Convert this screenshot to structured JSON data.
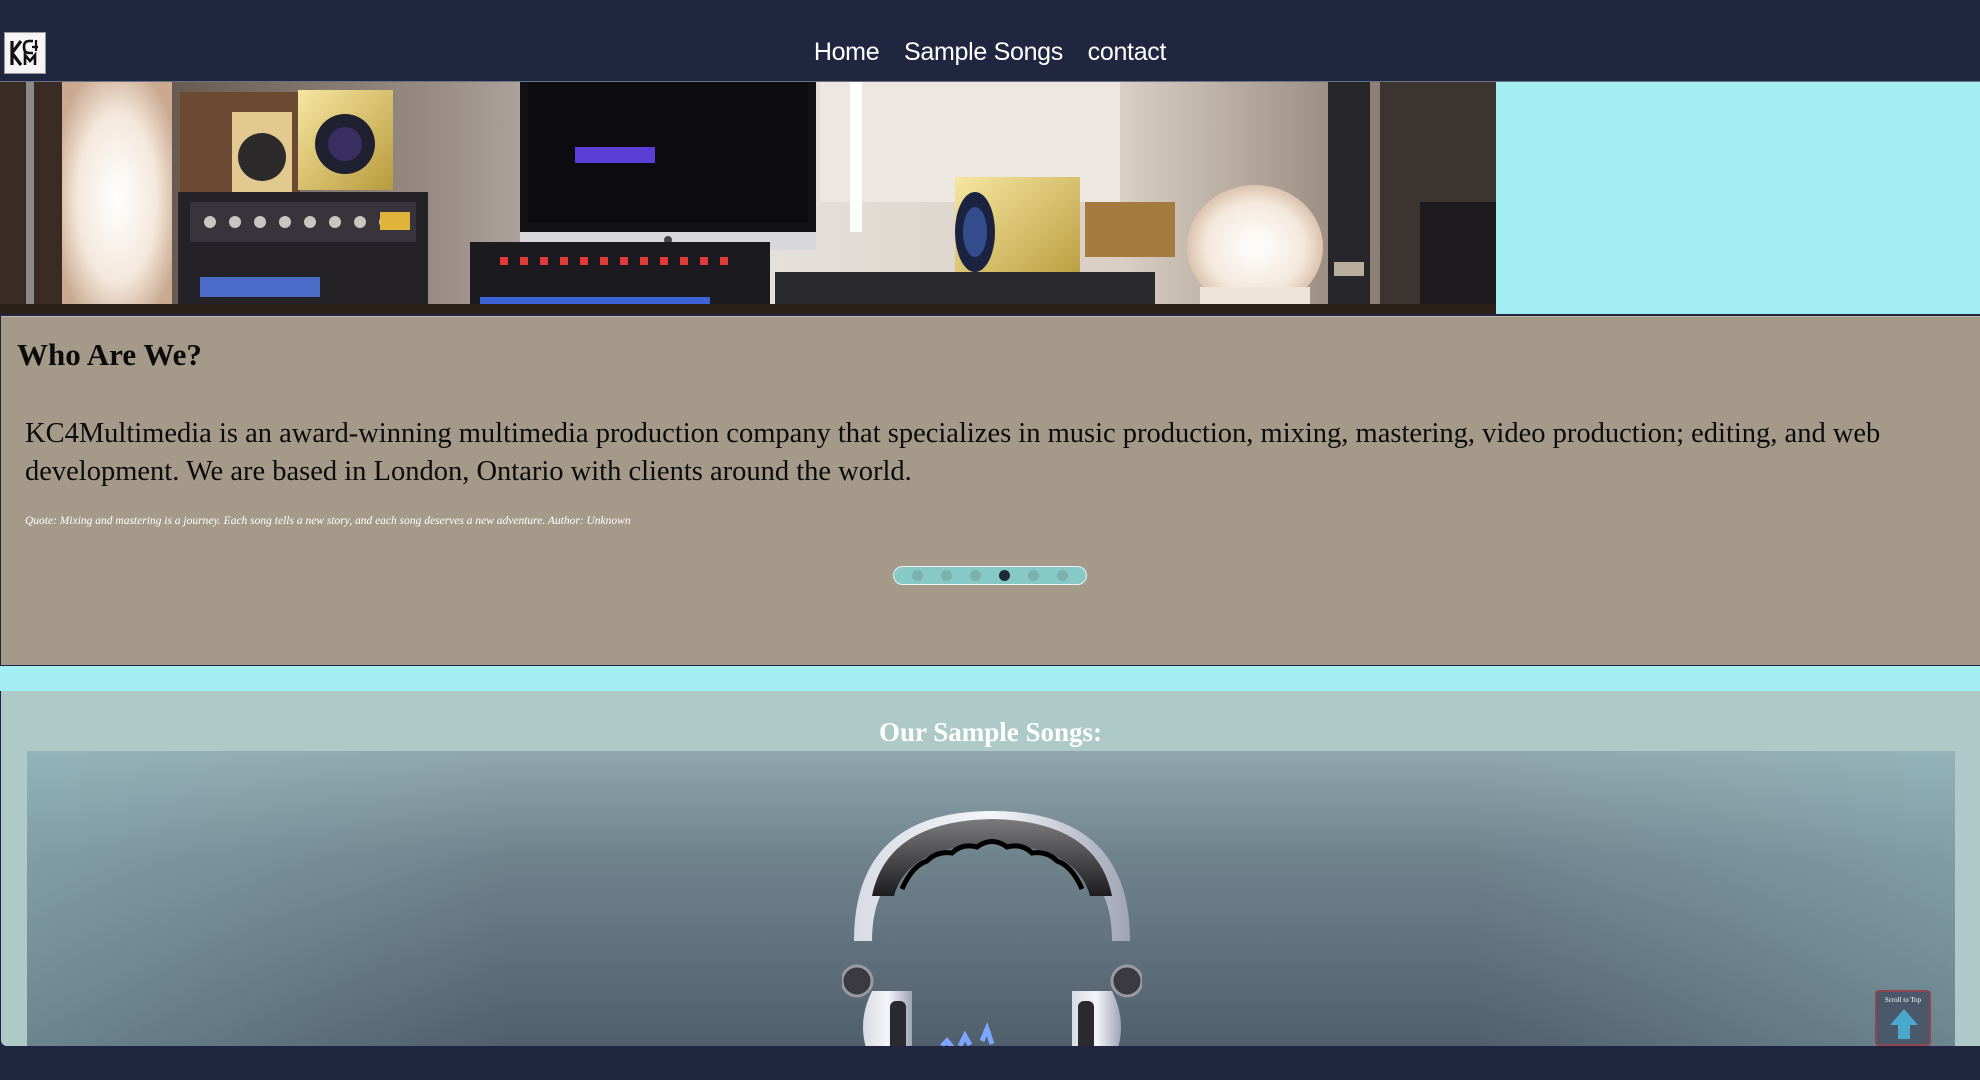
{
  "header": {
    "logo_alt": "KC4M",
    "nav": [
      "Home",
      "Sample Songs",
      "contact"
    ]
  },
  "about": {
    "title": "Who Are We?",
    "description": "KC4Multimedia is an award-winning multimedia production company that specializes in music production, mixing, mastering, video production; editing, and web development. We are based in London, Ontario with clients around the world.",
    "quote": "Quote: Mixing and mastering is a journey. Each song tells a new story, and each song deserves a new adventure. Author: Unknown",
    "carousel": {
      "total": 6,
      "active_index": 3
    }
  },
  "songs": {
    "title": "Our Sample Songs:"
  },
  "scroll_top": {
    "label": "Scroll to Top"
  },
  "colors": {
    "navy": "#212640",
    "cyan": "#a3eef2",
    "taupe": "#a5998a",
    "teal_grey": "#adcac9",
    "dot_active": "#1f2a36"
  }
}
